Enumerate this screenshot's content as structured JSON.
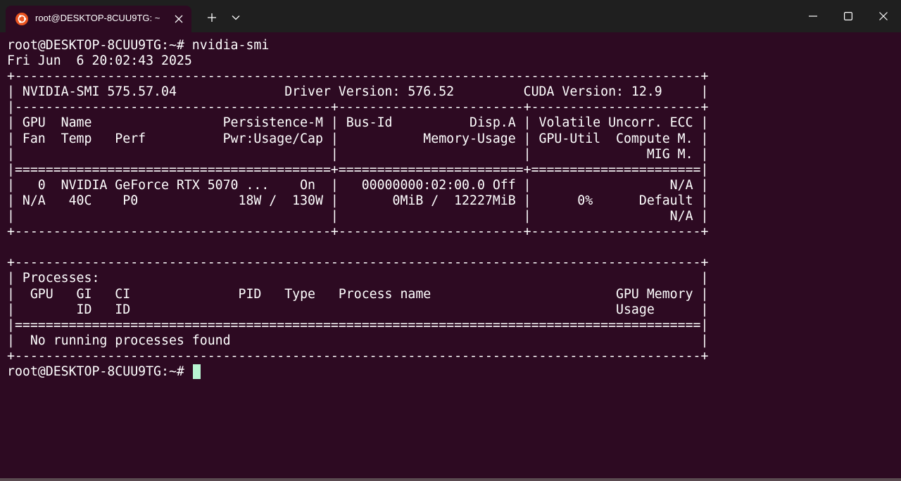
{
  "window": {
    "tab_title": "root@DESKTOP-8CUU9TG: ~",
    "tab_icon": "ubuntu-icon",
    "new_tab_icon": "plus-icon",
    "dropdown_icon": "chevron-down-icon",
    "controls": [
      "minimize-icon",
      "maximize-icon",
      "close-icon"
    ],
    "colors": {
      "titlebar": "#1f1f1f",
      "terminal_bg": "#2d0a22",
      "ubuntu_orange": "#e95420",
      "cursor": "#b8f5d2"
    }
  },
  "terminal": {
    "lines": [
      "root@DESKTOP-8CUU9TG:~# nvidia-smi",
      "Fri Jun  6 20:02:43 2025",
      "+-----------------------------------------------------------------------------------------+",
      "| NVIDIA-SMI 575.57.04              Driver Version: 576.52         CUDA Version: 12.9     |",
      "|-----------------------------------------+------------------------+----------------------+",
      "| GPU  Name                 Persistence-M | Bus-Id          Disp.A | Volatile Uncorr. ECC |",
      "| Fan  Temp   Perf          Pwr:Usage/Cap |           Memory-Usage | GPU-Util  Compute M. |",
      "|                                         |                        |               MIG M. |",
      "|=========================================+========================+======================|",
      "|   0  NVIDIA GeForce RTX 5070 ...    On  |   00000000:02:00.0 Off |                  N/A |",
      "| N/A   40C    P0             18W /  130W |       0MiB /  12227MiB |      0%      Default |",
      "|                                         |                        |                  N/A |",
      "+-----------------------------------------+------------------------+----------------------+",
      "",
      "+-----------------------------------------------------------------------------------------+",
      "| Processes:                                                                              |",
      "|  GPU   GI   CI              PID   Type   Process name                        GPU Memory |",
      "|        ID   ID                                                               Usage      |",
      "|=========================================================================================|",
      "|  No running processes found                                                             |",
      "+-----------------------------------------------------------------------------------------+"
    ],
    "prompt": "root@DESKTOP-8CUU9TG:~# "
  }
}
